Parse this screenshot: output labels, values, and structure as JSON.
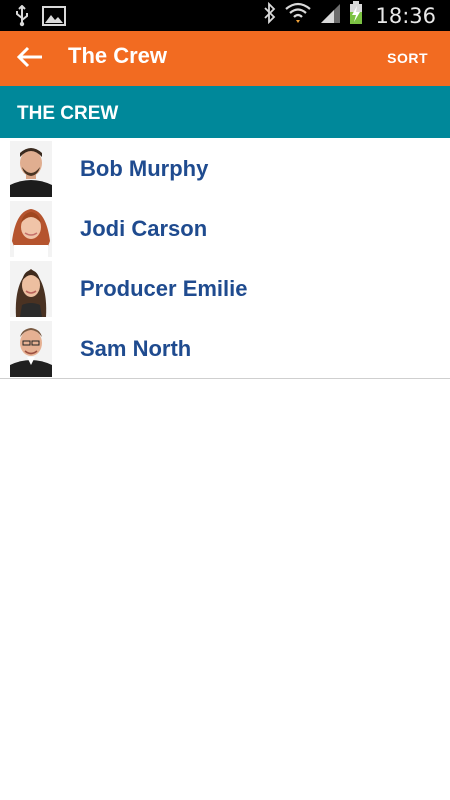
{
  "status_bar": {
    "time": "18:36",
    "icons": [
      "usb-icon",
      "image-notification-icon",
      "bluetooth-icon",
      "wifi-icon",
      "signal-icon",
      "battery-charging-icon"
    ]
  },
  "action_bar": {
    "title": "The Crew",
    "sort_label": "SORT",
    "color": "#f26b21"
  },
  "section": {
    "title": "THE CREW",
    "color": "#00889a"
  },
  "crew": [
    {
      "name": "Bob Murphy"
    },
    {
      "name": "Jodi Carson"
    },
    {
      "name": "Producer Emilie"
    },
    {
      "name": "Sam North"
    }
  ]
}
